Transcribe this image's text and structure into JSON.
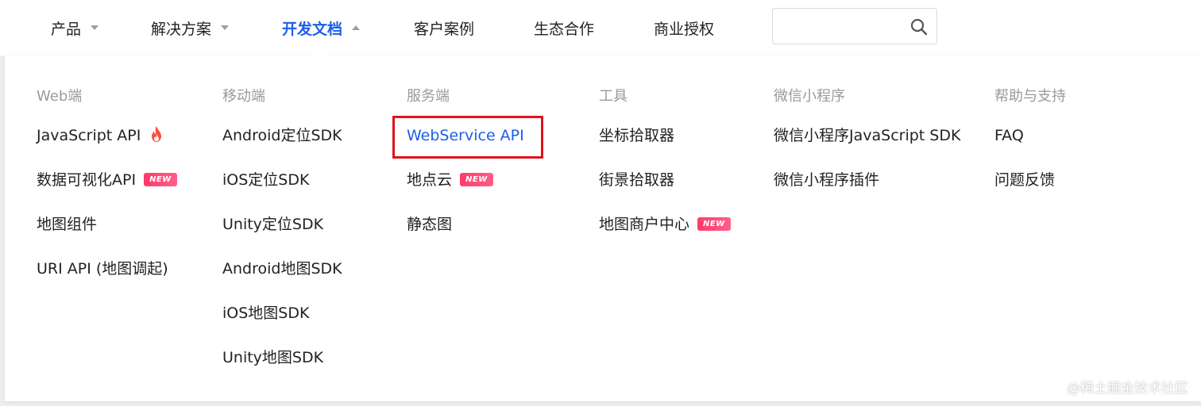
{
  "nav": {
    "items": [
      {
        "label": "产品",
        "caret": "down"
      },
      {
        "label": "解决方案",
        "caret": "down"
      },
      {
        "label": "开发文档",
        "caret": "up",
        "active": true
      },
      {
        "label": "客户案例"
      },
      {
        "label": "生态合作"
      },
      {
        "label": "商业授权"
      }
    ],
    "search": {
      "placeholder": "",
      "value": ""
    },
    "active_color": "#1f5ee8"
  },
  "menu": {
    "columns": [
      {
        "heading": "Web端",
        "links": [
          {
            "label": "JavaScript API",
            "icon": "fire-icon"
          },
          {
            "label": "数据可视化API",
            "badge": "NEW"
          },
          {
            "label": "地图组件"
          },
          {
            "label": "URI API (地图调起)"
          }
        ]
      },
      {
        "heading": "移动端",
        "links": [
          {
            "label": "Android定位SDK"
          },
          {
            "label": "iOS定位SDK"
          },
          {
            "label": "Unity定位SDK"
          },
          {
            "label": "Android地图SDK"
          },
          {
            "label": "iOS地图SDK"
          },
          {
            "label": "Unity地图SDK"
          }
        ]
      },
      {
        "heading": "服务端",
        "links": [
          {
            "label": "WebService API",
            "highlighted": true
          },
          {
            "label": "地点云",
            "badge": "NEW"
          },
          {
            "label": "静态图"
          }
        ]
      },
      {
        "heading": "工具",
        "links": [
          {
            "label": "坐标拾取器"
          },
          {
            "label": "街景拾取器"
          },
          {
            "label": "地图商户中心",
            "badge": "NEW"
          }
        ]
      },
      {
        "heading": "微信小程序",
        "links": [
          {
            "label": "微信小程序JavaScript SDK"
          },
          {
            "label": "微信小程序插件"
          }
        ]
      },
      {
        "heading": "帮助与支持",
        "links": [
          {
            "label": "FAQ"
          },
          {
            "label": "问题反馈"
          }
        ]
      }
    ],
    "highlight_color": "#e0131a",
    "badge_color": "#ff3b6b"
  },
  "watermark": "@稀土掘金技术社区"
}
